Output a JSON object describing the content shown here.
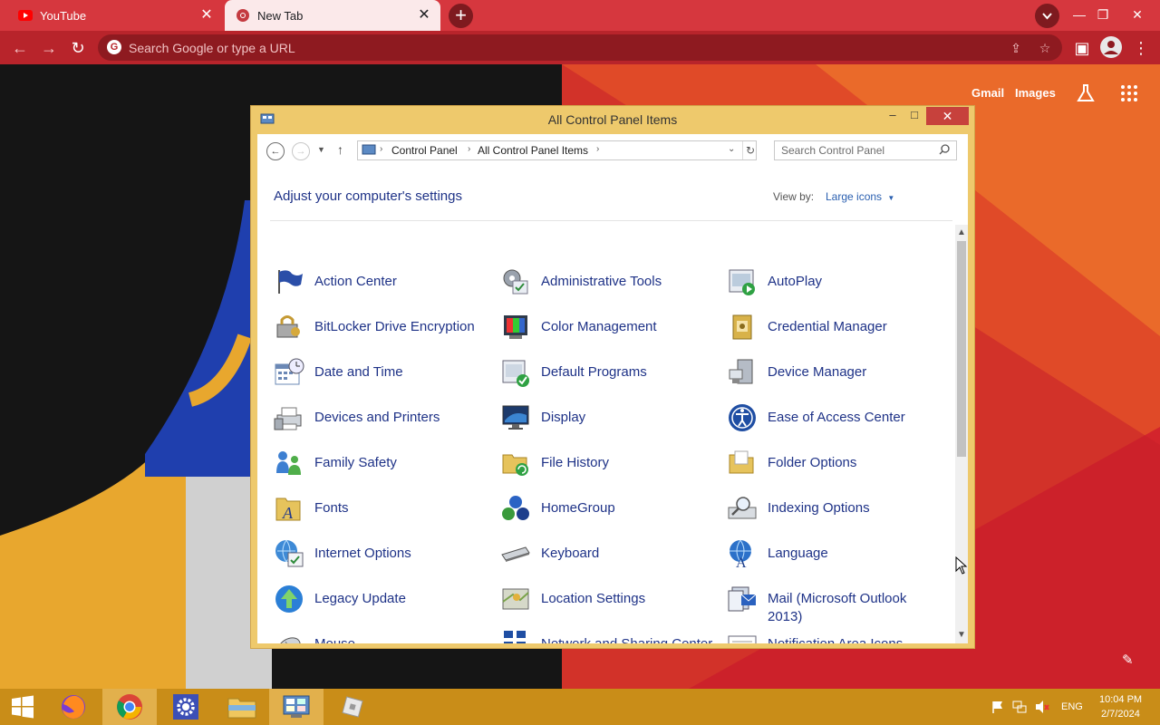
{
  "browser": {
    "tabs": [
      {
        "title": "YouTube",
        "favicon": "youtube-icon"
      },
      {
        "title": "New Tab",
        "favicon": "chrome-icon"
      }
    ],
    "new_tab_glyph": "+",
    "close_glyph": "✕",
    "omnibox_placeholder": "Search Google or type a URL",
    "accent": "#b8242b"
  },
  "ntp": {
    "links": [
      "Gmail",
      "Images"
    ]
  },
  "control_panel": {
    "window_title": "All Control Panel Items",
    "breadcrumb": [
      "Control Panel",
      "All Control Panel Items"
    ],
    "search_placeholder": "Search Control Panel",
    "heading": "Adjust your computer's settings",
    "view_by_label": "View by:",
    "view_by_value": "Large icons",
    "items": [
      {
        "label": "Action Center",
        "icon": "flag-icon"
      },
      {
        "label": "Administrative Tools",
        "icon": "admin-tools-icon"
      },
      {
        "label": "AutoPlay",
        "icon": "autoplay-icon"
      },
      {
        "label": "BitLocker Drive Encryption",
        "icon": "bitlocker-icon"
      },
      {
        "label": "Color Management",
        "icon": "color-management-icon"
      },
      {
        "label": "Credential Manager",
        "icon": "credential-icon"
      },
      {
        "label": "Date and Time",
        "icon": "calendar-clock-icon"
      },
      {
        "label": "Default Programs",
        "icon": "default-programs-icon"
      },
      {
        "label": "Device Manager",
        "icon": "device-manager-icon"
      },
      {
        "label": "Devices and Printers",
        "icon": "printer-icon"
      },
      {
        "label": "Display",
        "icon": "display-icon"
      },
      {
        "label": "Ease of Access Center",
        "icon": "ease-of-access-icon"
      },
      {
        "label": "Family Safety",
        "icon": "family-safety-icon"
      },
      {
        "label": "File History",
        "icon": "file-history-icon"
      },
      {
        "label": "Folder Options",
        "icon": "folder-options-icon"
      },
      {
        "label": "Fonts",
        "icon": "fonts-icon"
      },
      {
        "label": "HomeGroup",
        "icon": "homegroup-icon"
      },
      {
        "label": "Indexing Options",
        "icon": "indexing-icon"
      },
      {
        "label": "Internet Options",
        "icon": "internet-options-icon"
      },
      {
        "label": "Keyboard",
        "icon": "keyboard-icon"
      },
      {
        "label": "Language",
        "icon": "language-icon"
      },
      {
        "label": "Legacy Update",
        "icon": "legacy-update-icon"
      },
      {
        "label": "Location Settings",
        "icon": "location-icon"
      },
      {
        "label": "Mail (Microsoft Outlook 2013)",
        "icon": "mail-icon"
      },
      {
        "label": "Mouse",
        "icon": "mouse-icon"
      },
      {
        "label": "Network and Sharing Center",
        "icon": "network-icon"
      },
      {
        "label": "Notification Area Icons",
        "icon": "notification-icon"
      }
    ]
  },
  "taskbar": {
    "language": "ENG",
    "time": "10:04 PM",
    "date": "2/7/2024"
  }
}
